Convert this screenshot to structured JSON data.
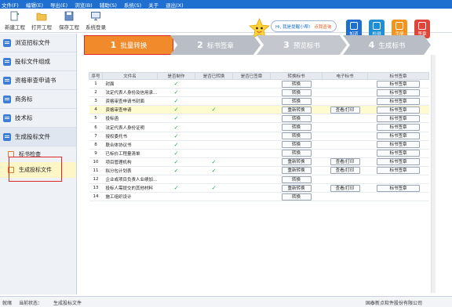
{
  "menu": [
    "文件(F)",
    "编辑(E)",
    "导出(E)",
    "浏览(B)",
    "辅助(S)",
    "系统(S)",
    "关于",
    "退出(X)"
  ],
  "toolbar": {
    "buttons": [
      {
        "label": "新建工程",
        "icon": "new-project-icon"
      },
      {
        "label": "打开工程",
        "icon": "open-folder-icon"
      },
      {
        "label": "保存工程",
        "icon": "save-icon"
      },
      {
        "label": "系统登录",
        "icon": "monitor-icon"
      }
    ],
    "greeting_text": "Hi, 我是提醒小帮! ",
    "greeting_link": "点我咨询",
    "right_buttons": [
      {
        "label": "知道",
        "color": "#1e6fd0"
      },
      {
        "label": "检测",
        "color": "#1e8fd6"
      },
      {
        "label": "手册",
        "color": "#f2941e"
      },
      {
        "label": "签章",
        "color": "#e0453a"
      }
    ]
  },
  "nav": {
    "items": [
      "浏览招标文件",
      "投标文件组成",
      "资格审查申请书",
      "商务标",
      "技术标",
      "生成投标文件"
    ],
    "sub_items": [
      "标书检查",
      "生成投标文件"
    ]
  },
  "steps": [
    {
      "num": "1",
      "label": "批量转换"
    },
    {
      "num": "2",
      "label": "标书签章"
    },
    {
      "num": "3",
      "label": "预览标书"
    },
    {
      "num": "4",
      "label": "生成标书"
    }
  ],
  "table": {
    "headers": [
      "序号",
      "文件名",
      "是否制作",
      "是否已转换",
      "是否已签章",
      "转换标书",
      "电子标书",
      "标书签章"
    ],
    "rows": [
      {
        "no": "1",
        "name": "封面",
        "made": "✓",
        "converted": "",
        "convert_btn": "转换",
        "view_btn": "",
        "sign_btn": "标书签章",
        "hl": false
      },
      {
        "no": "2",
        "name": "法定代表人身份及信用承...",
        "made": "✓",
        "converted": "",
        "convert_btn": "转换",
        "view_btn": "",
        "sign_btn": "标书签章",
        "hl": false
      },
      {
        "no": "3",
        "name": "资格审查申请书封面",
        "made": "✓",
        "converted": "",
        "convert_btn": "转换",
        "view_btn": "",
        "sign_btn": "标书签章",
        "hl": false
      },
      {
        "no": "4",
        "name": "资格审查申请",
        "made": "✓",
        "converted": "✓",
        "convert_btn": "重新转换",
        "view_btn": "查看/打印",
        "sign_btn": "标书签章",
        "hl": true
      },
      {
        "no": "5",
        "name": "投标函",
        "made": "✓",
        "converted": "",
        "convert_btn": "转换",
        "view_btn": "",
        "sign_btn": "标书签章",
        "hl": false
      },
      {
        "no": "6",
        "name": "法定代表人身份证明",
        "made": "✓",
        "converted": "",
        "convert_btn": "转换",
        "view_btn": "",
        "sign_btn": "标书签章",
        "hl": false
      },
      {
        "no": "7",
        "name": "授权委托书",
        "made": "✓",
        "converted": "",
        "convert_btn": "转换",
        "view_btn": "",
        "sign_btn": "标书签章",
        "hl": false
      },
      {
        "no": "8",
        "name": "联合体协议书",
        "made": "✓",
        "converted": "",
        "convert_btn": "转换",
        "view_btn": "",
        "sign_btn": "标书签章",
        "hl": false
      },
      {
        "no": "9",
        "name": "已标价工程量清单",
        "made": "✓",
        "converted": "",
        "convert_btn": "转换",
        "view_btn": "",
        "sign_btn": "标书签章",
        "hl": false
      },
      {
        "no": "10",
        "name": "项目管理机构",
        "made": "✓",
        "converted": "✓",
        "convert_btn": "重新转换",
        "view_btn": "查看/打印",
        "sign_btn": "标书签章",
        "hl": false
      },
      {
        "no": "11",
        "name": "拟分包计划表",
        "made": "✓",
        "converted": "✓",
        "convert_btn": "重新转换",
        "view_btn": "查看/打印",
        "sign_btn": "标书签章",
        "hl": false
      },
      {
        "no": "12",
        "name": "企业或项目负责人业绩加...",
        "made": "",
        "converted": "",
        "convert_btn": "转换",
        "view_btn": "",
        "sign_btn": "",
        "hl": false
      },
      {
        "no": "13",
        "name": "投标人需提交的其他材料",
        "made": "✓",
        "converted": "✓",
        "convert_btn": "重新转换",
        "view_btn": "查看/打印",
        "sign_btn": "标书签章",
        "hl": false
      },
      {
        "no": "14",
        "name": "施工组织设计",
        "made": "",
        "converted": "",
        "convert_btn": "转换",
        "view_btn": "",
        "sign_btn": "",
        "hl": false
      }
    ]
  },
  "status": {
    "ready": "就绪",
    "state_label": "当前状态：",
    "state_value": "生成投标文件",
    "company": "国泰新点软件股份有限公司"
  }
}
